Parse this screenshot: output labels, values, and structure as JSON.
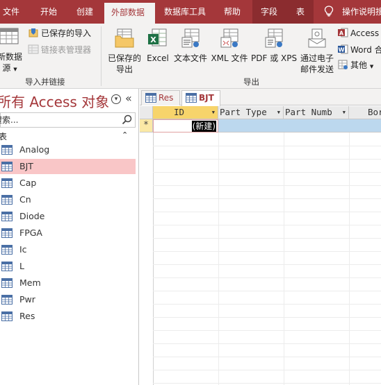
{
  "ribbon_tabs": [
    {
      "label": "文件"
    },
    {
      "label": "开始"
    },
    {
      "label": "创建"
    },
    {
      "label": "外部数据"
    },
    {
      "label": "数据库工具"
    },
    {
      "label": "帮助"
    },
    {
      "label": "字段"
    },
    {
      "label": "表"
    }
  ],
  "tell_me": "操作说明搜",
  "import_group": {
    "new_source_label_line1": "新数据",
    "new_source_label_line2": "源",
    "saved_imports": "已保存的导入",
    "linked_table_manager": "链接表管理器",
    "group_label": "导入并链接"
  },
  "export_group": {
    "saved_exports_line1": "已保存的",
    "saved_exports_line2": "导出",
    "excel": "Excel",
    "text_file": "文本文件",
    "xml_file": "XML 文件",
    "pdf_xps": "PDF 或 XPS",
    "email_line1": "通过电子",
    "email_line2": "邮件发送",
    "access": "Access",
    "word": "Word 合",
    "other": "其他",
    "group_label": "导出"
  },
  "nav": {
    "title": "所有 Access 对象",
    "search_placeholder": "搜索...",
    "group_label": "表",
    "items": [
      {
        "label": "Analog"
      },
      {
        "label": "BJT"
      },
      {
        "label": "Cap"
      },
      {
        "label": "Cn"
      },
      {
        "label": "Diode"
      },
      {
        "label": "FPGA"
      },
      {
        "label": "Ic"
      },
      {
        "label": "L"
      },
      {
        "label": "Mem"
      },
      {
        "label": "Pwr"
      },
      {
        "label": "Res"
      }
    ]
  },
  "doc_tabs": [
    {
      "label": "Res"
    },
    {
      "label": "BJT"
    }
  ],
  "grid": {
    "columns": [
      "ID",
      "Part Type",
      "Part Numb",
      "Bor"
    ],
    "new_row_marker": "*",
    "new_row_id": "(新建)"
  },
  "colors": {
    "accent": "#a4373a",
    "selected_nav": "#f9c6c7",
    "new_row": "#bcd8ee"
  }
}
